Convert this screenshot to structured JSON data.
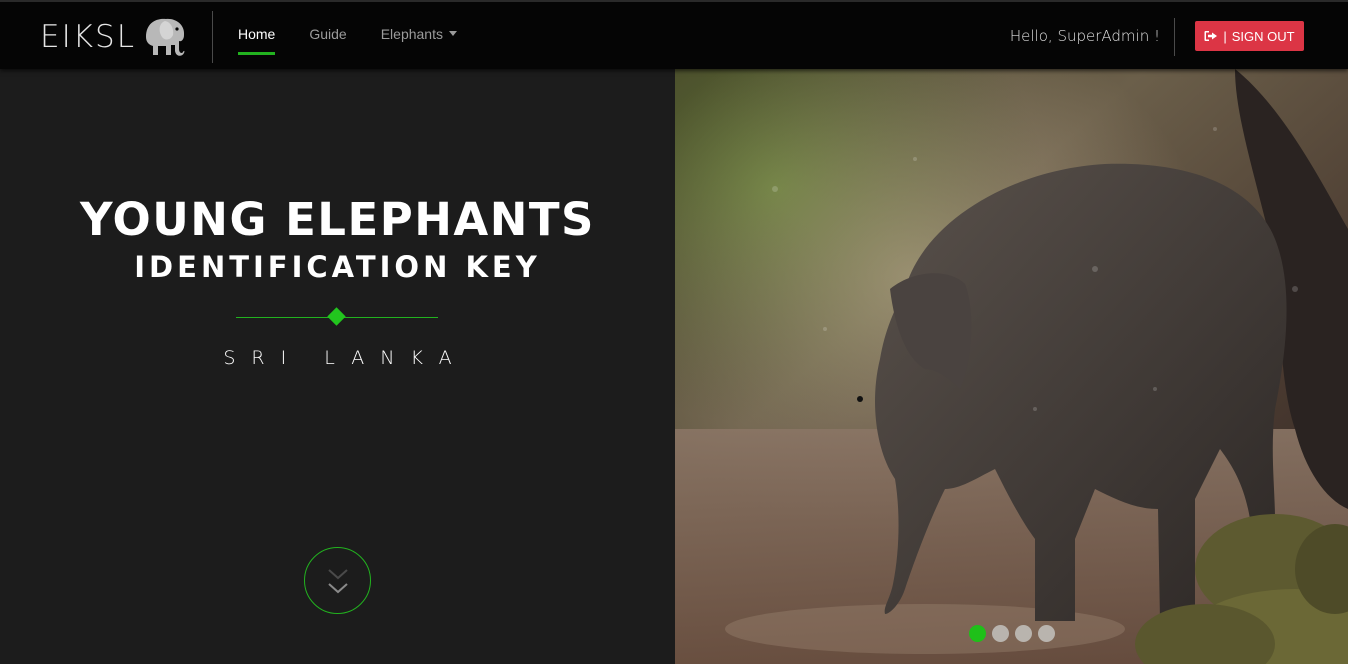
{
  "brand": {
    "text": "EIKSL",
    "logo_icon": "elephant-icon"
  },
  "nav": {
    "items": [
      {
        "label": "Home",
        "active": true
      },
      {
        "label": "Guide",
        "active": false
      },
      {
        "label": "Elephants",
        "active": false,
        "dropdown": true
      }
    ]
  },
  "user": {
    "greeting": "Hello, SuperAdmin !"
  },
  "signout": {
    "icon": "sign-out-icon",
    "separator": "|",
    "label": "SIGN OUT"
  },
  "hero": {
    "title": "YOUNG ELEPHANTS",
    "subtitle": "IDENTIFICATION KEY",
    "location": "SRI LANKA",
    "scroll_icon": "chevron-double-down-icon"
  },
  "carousel": {
    "slide_count": 4,
    "active_index": 0
  },
  "colors": {
    "accent": "#22b21f",
    "danger": "#dc3545",
    "background": "#1c1c1c",
    "navbar": "#050505"
  }
}
